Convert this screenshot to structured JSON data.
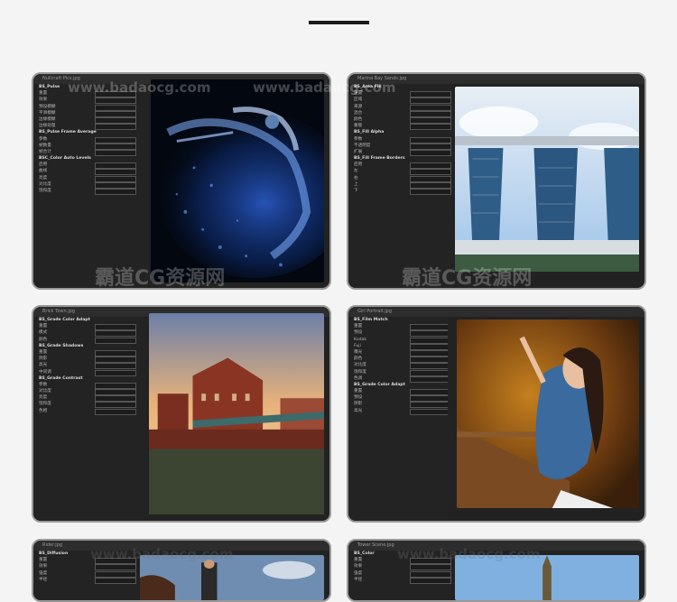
{
  "cards": [
    {
      "title": "Nullcraft Pics.jpg",
      "rows": [
        "BS_Pulse",
        "重置",
        "效果",
        "预设模糊",
        "平滑模糊",
        "边缘模糊",
        "边缘处理",
        "BS_Pulse Frame Average",
        "参数",
        "帧数量",
        "帧合计",
        "BSC_Color Auto Levels",
        "启用",
        "曲线",
        "亮度",
        "对比度",
        "饱和度"
      ]
    },
    {
      "title": "Marina Bay Sands.jpg",
      "rows": [
        "BS_Area Fill",
        "重置",
        "区域",
        "来源",
        "混合",
        "颜色",
        "蒙版",
        "BS_Fill Alpha",
        "参数",
        "不透明度",
        "扩展",
        "BS_Fill Frame Borders",
        "启用",
        "左",
        "右",
        "上",
        "下"
      ]
    },
    {
      "title": "Brick Town.jpg",
      "rows": [
        "BS_Grade Color Adapt",
        "重置",
        "模式",
        "颜色",
        "BS_Grade Shadows",
        "重置",
        "阴影",
        "高光",
        "中间调",
        "BS_Grade Contrast",
        "参数",
        "对比度",
        "亮度",
        "饱和度",
        "色相"
      ]
    },
    {
      "title": "Girl Portrait.jpg",
      "rows": [
        "BS_Film Match",
        "重置",
        "预设",
        "Kodak",
        "Fuji",
        "曝光",
        "颜色",
        "对比度",
        "饱和度",
        "色调",
        "BS_Grade Color Adapt",
        "重置",
        "预设",
        "阴影",
        "高光"
      ]
    },
    {
      "title": "Rider.jpg",
      "rows": [
        "BS_Diffusion",
        "重置",
        "效果",
        "强度",
        "半径"
      ]
    },
    {
      "title": "Tower Scene.jpg",
      "rows": [
        "BS_Color",
        "重置",
        "效果",
        "强度",
        "半径"
      ]
    }
  ],
  "watermark": {
    "site": "www.badaocg.com",
    "brand": "霸道CG资源网"
  }
}
